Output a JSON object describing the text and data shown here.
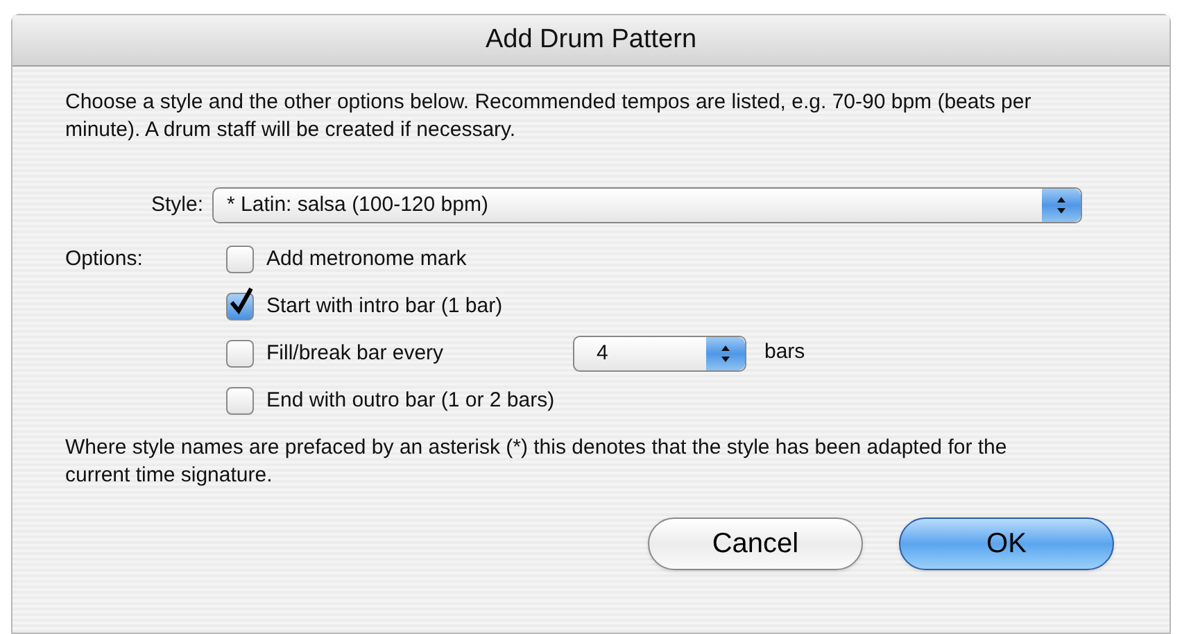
{
  "window": {
    "title": "Add Drum Pattern"
  },
  "intro": "Choose a style and the other options below. Recommended tempos are listed, e.g. 70-90 bpm (beats per minute). A drum staff will be created if necessary.",
  "style": {
    "label": "Style:",
    "value": "* Latin: salsa (100-120 bpm)"
  },
  "options_label": "Options:",
  "options": [
    {
      "kind": "checkbox",
      "label": "Add metronome mark",
      "checked": false
    },
    {
      "kind": "checkbox",
      "label": "Start with intro bar (1 bar)",
      "checked": true
    },
    {
      "kind": "checkbox_select",
      "label": "Fill/break bar every",
      "checked": false,
      "value": "4",
      "suffix": "bars"
    },
    {
      "kind": "checkbox",
      "label": "End with outro bar (1 or 2 bars)",
      "checked": false
    }
  ],
  "note": "Where style names are prefaced by an asterisk (*) this denotes that the style has been adapted for the current time signature.",
  "buttons": [
    {
      "label": "Cancel",
      "default": false
    },
    {
      "label": "OK",
      "default": true
    }
  ]
}
